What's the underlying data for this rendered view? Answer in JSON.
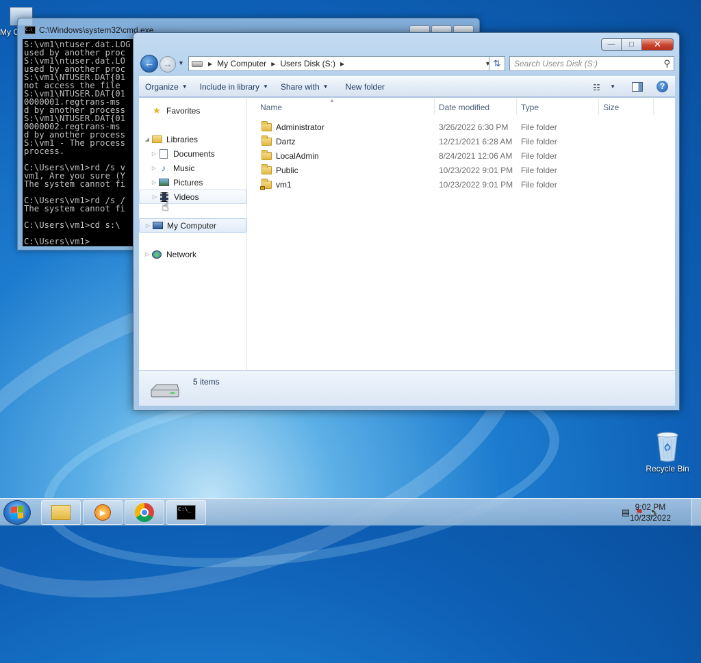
{
  "desktop": {
    "icons": [
      {
        "label": "My C",
        "name": "my-computer"
      },
      {
        "label": "Recycle Bin",
        "name": "recycle-bin"
      }
    ]
  },
  "cmd": {
    "title": "C:\\Windows\\system32\\cmd.exe",
    "lines": [
      "S:\\vm1\\ntuser.dat.LOG",
      "used by another proc",
      "S:\\vm1\\ntuser.dat.LO",
      "used by another proc",
      "S:\\vm1\\NTUSER.DAT{01",
      "not access the file",
      "S:\\vm1\\NTUSER.DAT{01",
      "0000001.regtrans-ms",
      "d by another process",
      "S:\\vm1\\NTUSER.DAT{01",
      "0000002.regtrans-ms",
      "d by another process",
      "S:\\vm1 - The process",
      "process.",
      "",
      "C:\\Users\\vm1>rd /s v",
      "vm1, Are you sure (Y",
      "The system cannot fi",
      "",
      "C:\\Users\\vm1>rd /s /",
      "The system cannot fi",
      "",
      "C:\\Users\\vm1>cd s:\\",
      "",
      "C:\\Users\\vm1>"
    ]
  },
  "explorer": {
    "address": {
      "crumbs": [
        "My Computer",
        "Users Disk (S:)"
      ]
    },
    "search": {
      "placeholder": "Search Users Disk (S:)"
    },
    "toolbar": {
      "organize": "Organize",
      "include": "Include in library",
      "share": "Share with",
      "new_folder": "New folder"
    },
    "nav": {
      "favorites": "Favorites",
      "libraries": "Libraries",
      "documents": "Documents",
      "music": "Music",
      "pictures": "Pictures",
      "videos": "Videos",
      "my_computer": "My Computer",
      "network": "Network"
    },
    "columns": {
      "name": "Name",
      "date": "Date modified",
      "type": "Type",
      "size": "Size"
    },
    "files": [
      {
        "name": "Administrator",
        "date": "3/26/2022 6:30 PM",
        "type": "File folder"
      },
      {
        "name": "Dartz",
        "date": "12/21/2021 6:28 AM",
        "type": "File folder"
      },
      {
        "name": "LocalAdmin",
        "date": "8/24/2021 12:06 AM",
        "type": "File folder"
      },
      {
        "name": "Public",
        "date": "10/23/2022 9:01 PM",
        "type": "File folder"
      },
      {
        "name": "vm1",
        "date": "10/23/2022 9:01 PM",
        "type": "File folder"
      }
    ],
    "status": {
      "items": "5 items"
    }
  },
  "taskbar": {
    "time": "9:02 PM",
    "date": "10/23/2022"
  }
}
